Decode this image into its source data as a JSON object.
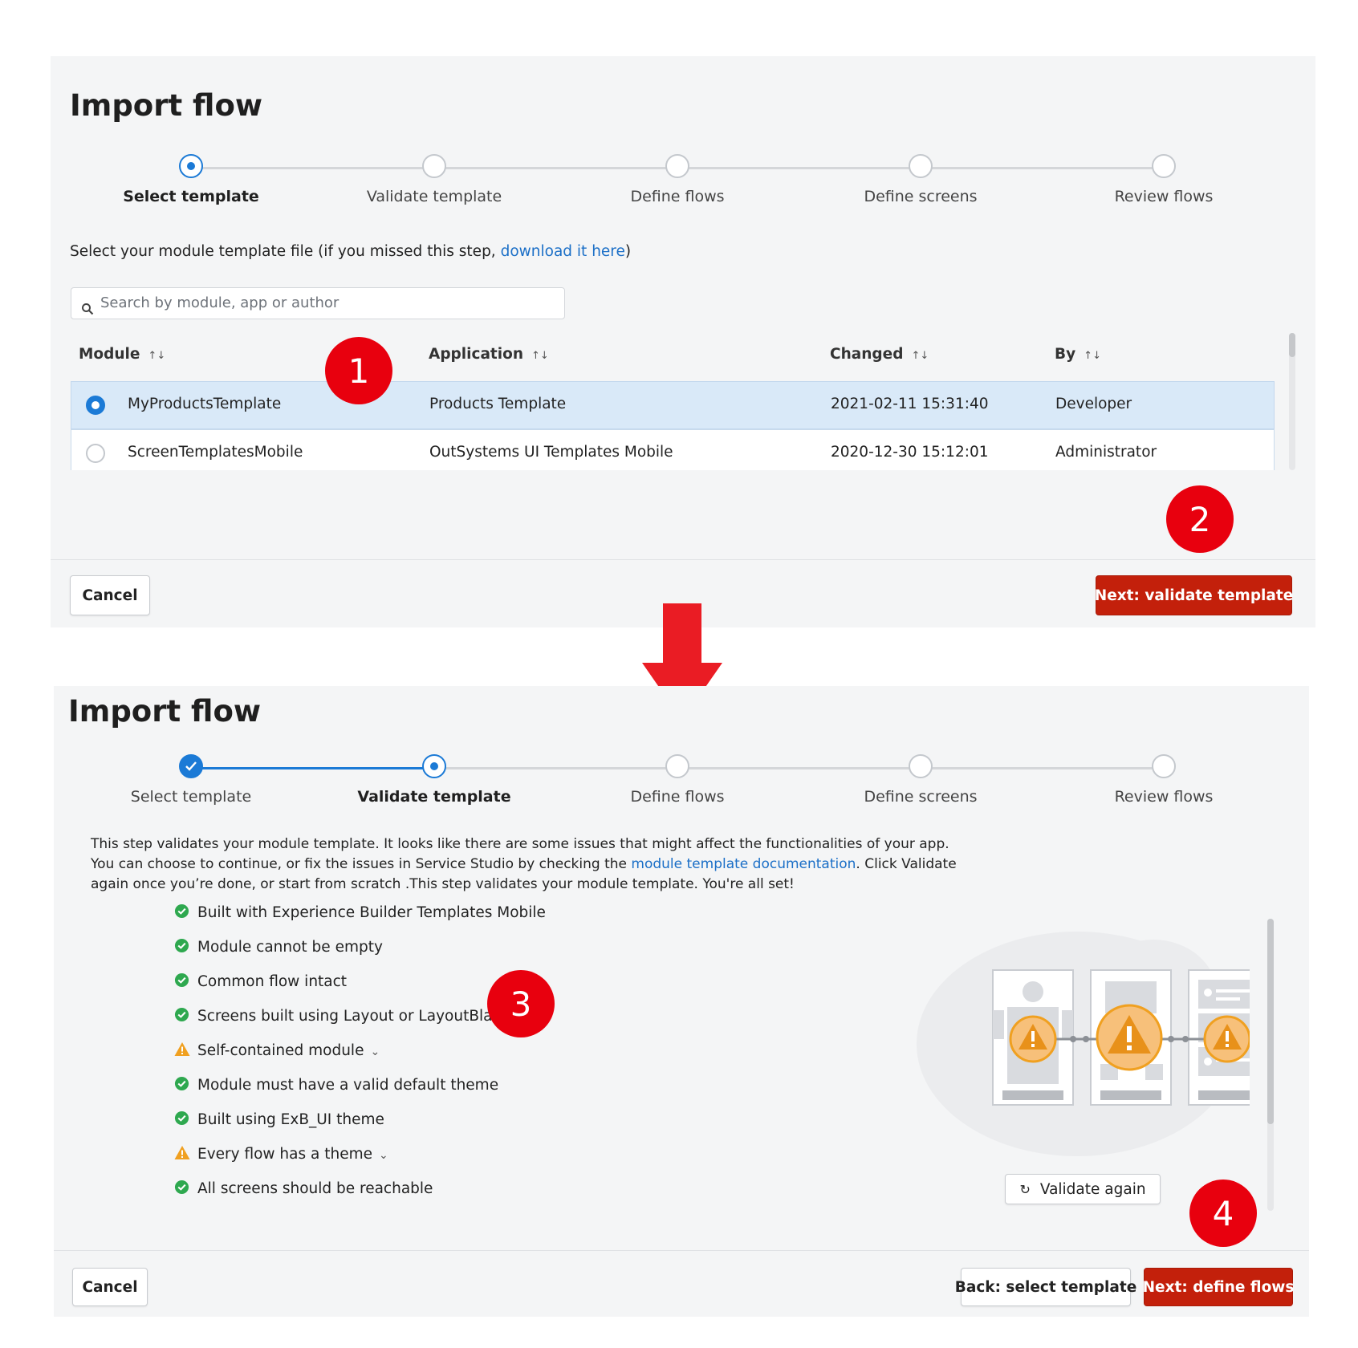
{
  "top": {
    "title": "Import flow",
    "steps": [
      {
        "label": "Select template"
      },
      {
        "label": "Validate template"
      },
      {
        "label": "Define flows"
      },
      {
        "label": "Define screens"
      },
      {
        "label": "Review flows"
      }
    ],
    "intro_before": "Select your module template file (if you missed this step, ",
    "intro_link": "download it here",
    "intro_after": ")",
    "search_placeholder": "Search by module, app or author",
    "table": {
      "columns": [
        "Module",
        "Application",
        "Changed",
        "By"
      ],
      "rows": [
        {
          "module": "MyProductsTemplate",
          "application": "Products Template",
          "changed": "2021-02-11 15:31:40",
          "by": "Developer",
          "selected": true
        },
        {
          "module": "ScreenTemplatesMobile",
          "application": "OutSystems UI Templates Mobile",
          "changed": "2020-12-30 15:12:01",
          "by": "Administrator",
          "selected": false
        }
      ]
    },
    "cancel_label": "Cancel",
    "next_label": "Next: validate template"
  },
  "bottom": {
    "title": "Import flow",
    "steps": [
      {
        "label": "Select template"
      },
      {
        "label": "Validate template"
      },
      {
        "label": "Define flows"
      },
      {
        "label": "Define screens"
      },
      {
        "label": "Review flows"
      }
    ],
    "intro_line1": "This step validates your module template. It looks like there are some issues that might affect the functionalities of your app.",
    "intro_line2_before": "You can choose to continue, or fix the issues in Service Studio by checking the ",
    "intro_link": "module template documentation",
    "intro_line2_after": ". Click Validate",
    "intro_line3": "again once you’re done, or start from scratch .This step validates your module template. You're all set!",
    "checks": [
      {
        "label": "Built with Experience Builder Templates Mobile",
        "status": "ok"
      },
      {
        "label": "Module cannot be empty",
        "status": "ok"
      },
      {
        "label": "Common flow intact",
        "status": "ok"
      },
      {
        "label": "Screens built using Layout or LayoutBlank",
        "status": "ok"
      },
      {
        "label": "Self-contained module",
        "status": "warning"
      },
      {
        "label": "Module must have a valid default theme",
        "status": "ok"
      },
      {
        "label": "Built using ExB_UI theme",
        "status": "ok"
      },
      {
        "label": "Every flow has a theme",
        "status": "warning"
      },
      {
        "label": "All screens should be reachable",
        "status": "ok"
      }
    ],
    "validate_again_label": "Validate again",
    "cancel_label": "Cancel",
    "back_label": "Back: select template",
    "next_label": "Next: define flows"
  },
  "annotations": [
    "1",
    "2",
    "3",
    "4"
  ],
  "colors": {
    "accent_blue": "#1b7ad6",
    "primary_red": "#c3200b",
    "badge_red": "#e8000e",
    "ok_green": "#2ea84f",
    "warning_orange": "#f0a020"
  }
}
